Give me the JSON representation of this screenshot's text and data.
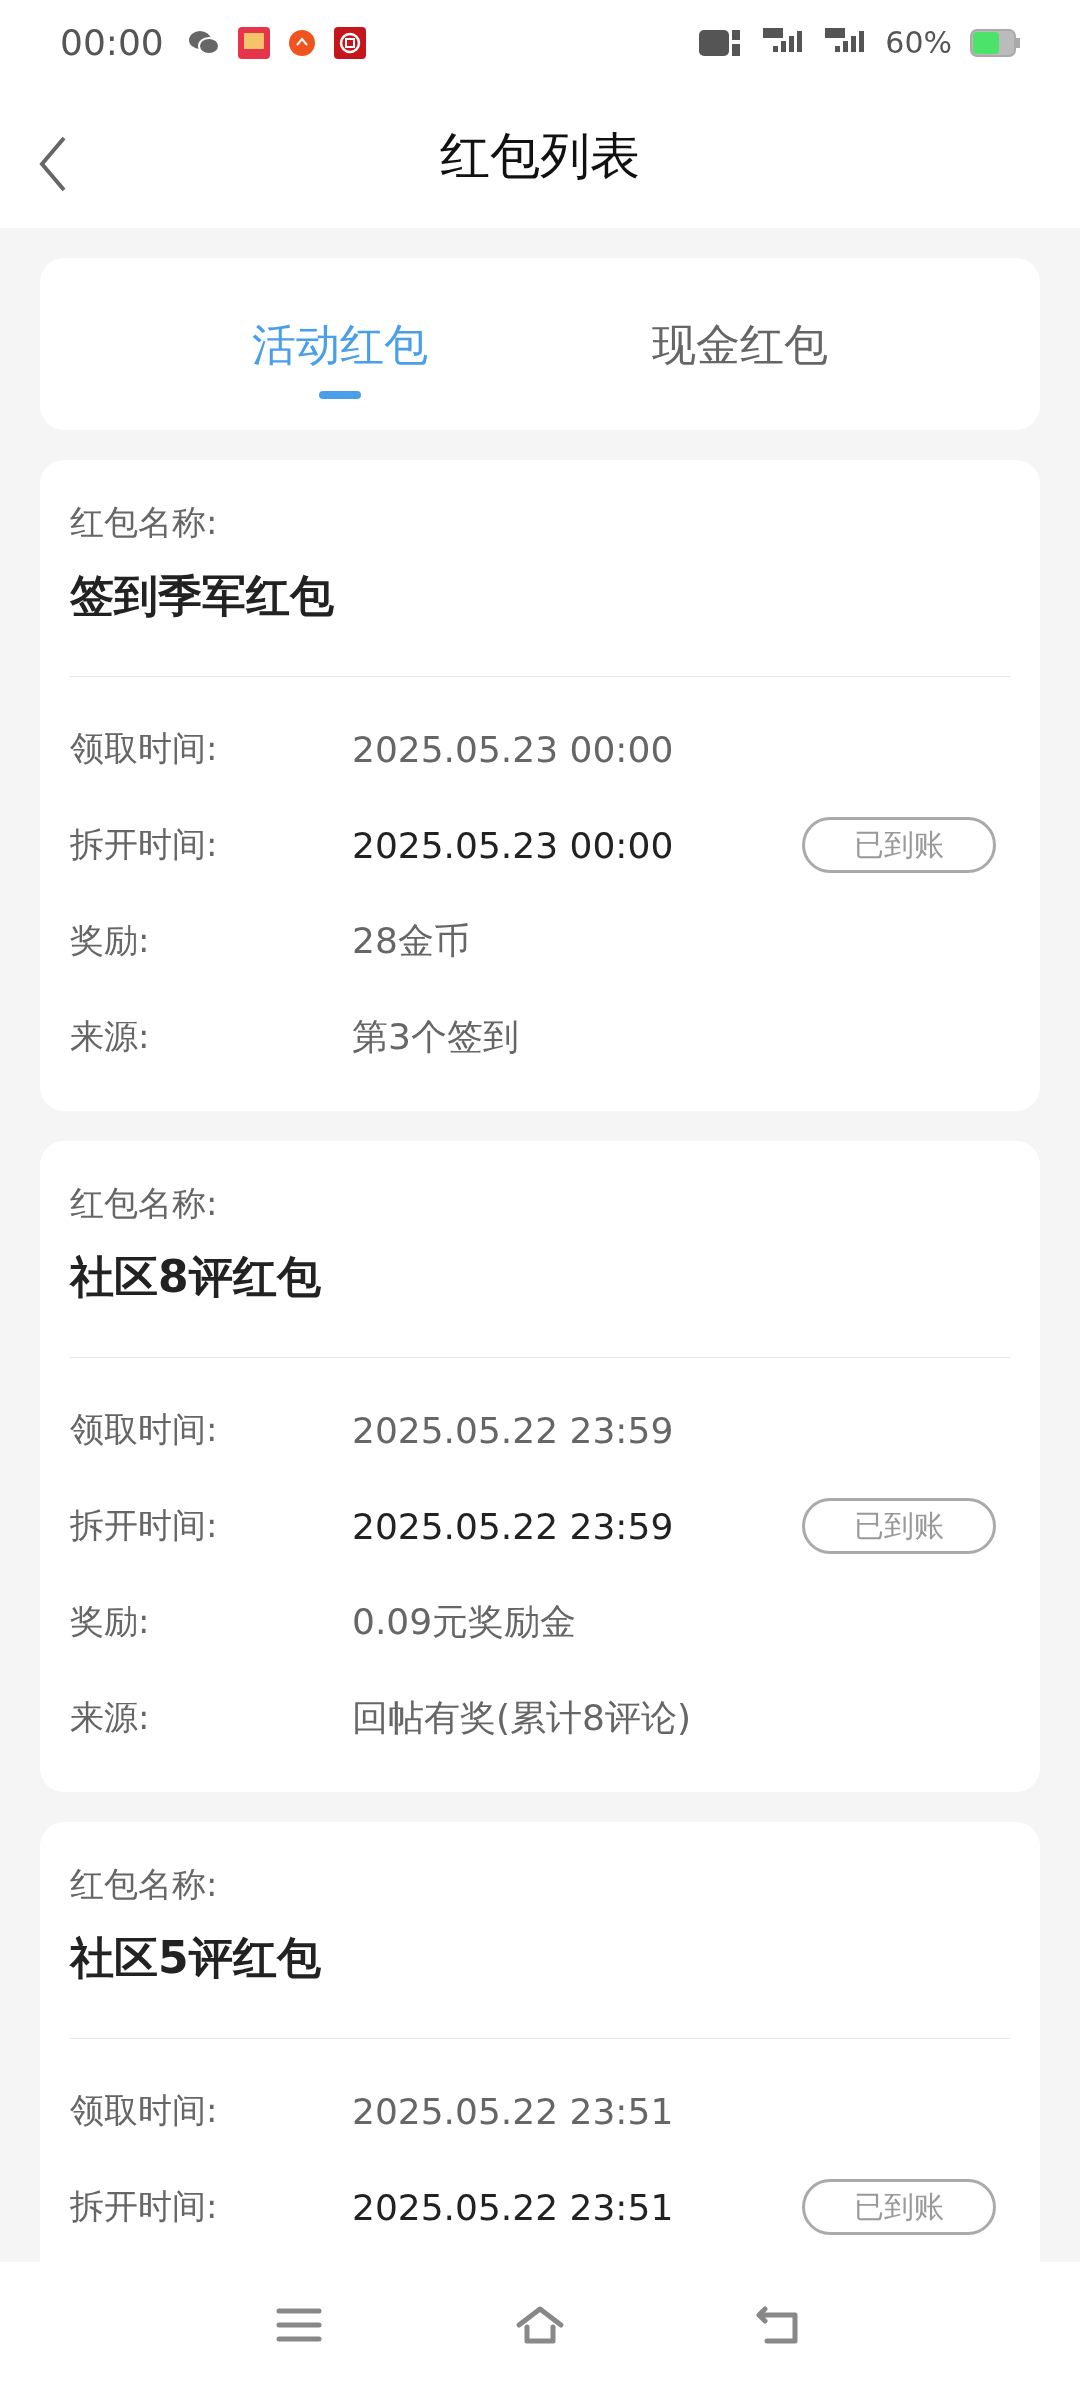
{
  "status_bar": {
    "time": "00:00",
    "battery": "60%"
  },
  "header": {
    "title": "红包列表"
  },
  "tabs": [
    {
      "label": "活动红包",
      "selected": true
    },
    {
      "label": "现金红包",
      "selected": false
    }
  ],
  "cards": [
    {
      "name_label": "红包名称:",
      "name": "签到季军红包",
      "rows": [
        {
          "kind": "plain",
          "label": "领取时间:",
          "value": "2025.05.23 00:00"
        },
        {
          "kind": "highlight",
          "label": "拆开时间:",
          "value": "2025.05.23 00:00",
          "badge": "已到账"
        },
        {
          "kind": "plain",
          "label": "奖励:",
          "value": "28金币"
        },
        {
          "kind": "plain",
          "label": "来源:",
          "value": "第3个签到"
        }
      ]
    },
    {
      "name_label": "红包名称:",
      "name": "社区8评红包",
      "rows": [
        {
          "kind": "plain",
          "label": "领取时间:",
          "value": "2025.05.22 23:59"
        },
        {
          "kind": "highlight",
          "label": "拆开时间:",
          "value": "2025.05.22 23:59",
          "badge": "已到账"
        },
        {
          "kind": "plain",
          "label": "奖励:",
          "value": "0.09元奖励金"
        },
        {
          "kind": "plain",
          "label": "来源:",
          "value": "回帖有奖(累计8评论)"
        }
      ]
    },
    {
      "name_label": "红包名称:",
      "name": "社区5评红包",
      "rows": [
        {
          "kind": "plain",
          "label": "领取时间:",
          "value": "2025.05.22 23:51"
        },
        {
          "kind": "highlight",
          "label": "拆开时间:",
          "value": "2025.05.22 23:51",
          "badge": "已到账"
        }
      ]
    }
  ]
}
